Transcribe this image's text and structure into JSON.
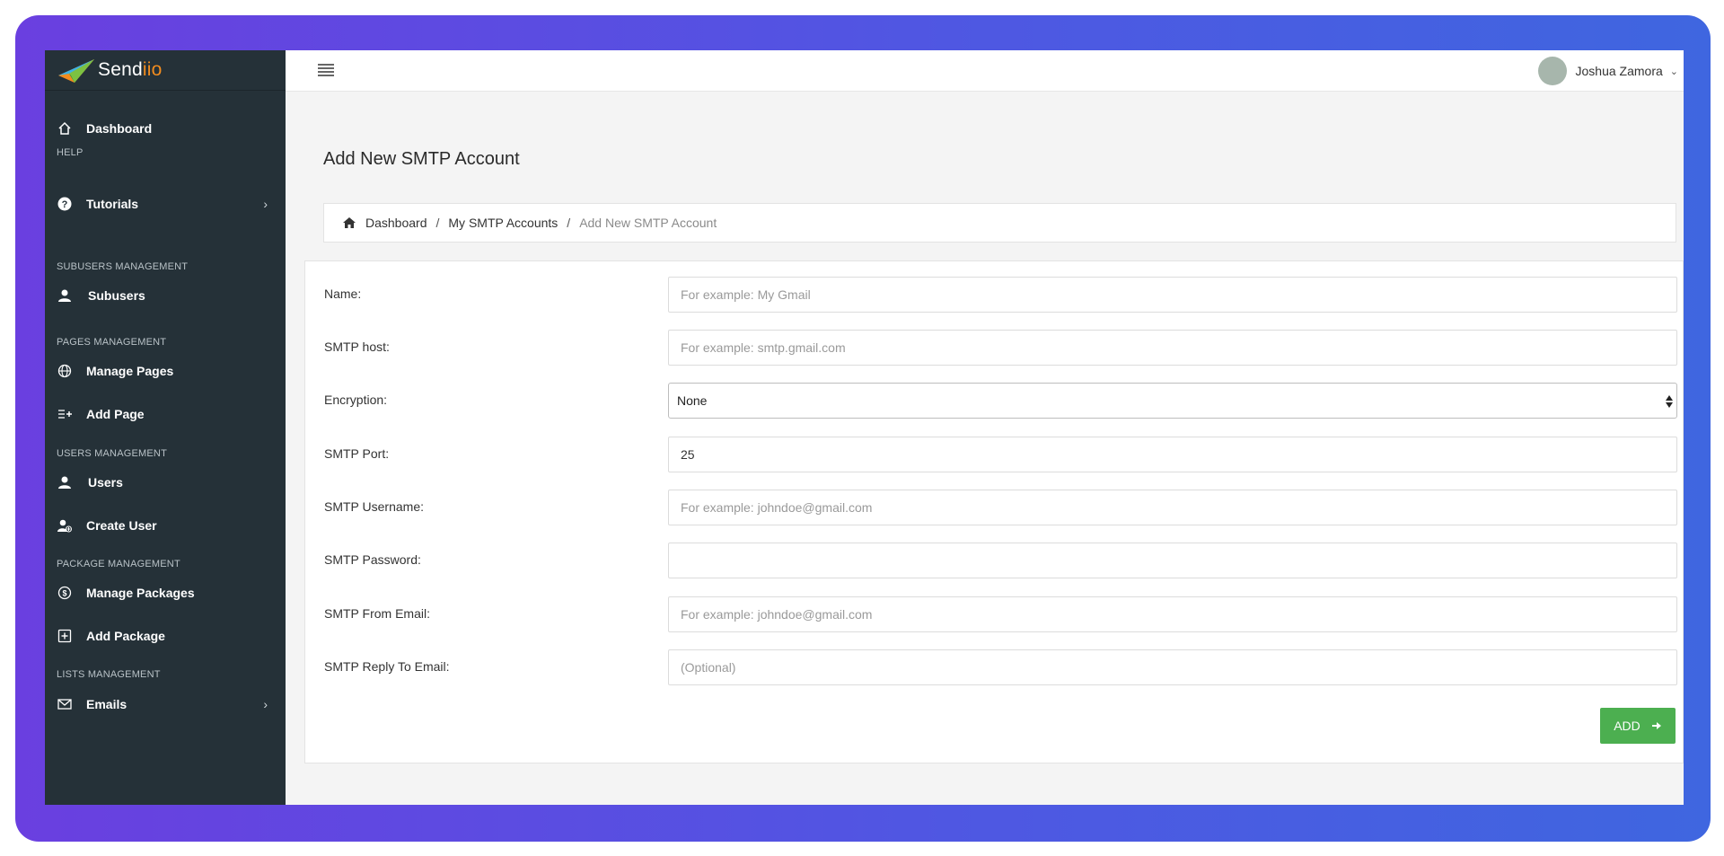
{
  "brand": {
    "logo_text_main": "Send",
    "logo_text_accent": "iio"
  },
  "sidebar": {
    "items": [
      {
        "label": "Dashboard",
        "icon": "home-icon"
      },
      {
        "label": "Tutorials",
        "icon": "help-circle-icon",
        "chevron": "›"
      },
      {
        "label": "Subusers",
        "icon": "user-icon"
      },
      {
        "label": "Manage Pages",
        "icon": "globe-icon"
      },
      {
        "label": "Add Page",
        "icon": "list-add-icon"
      },
      {
        "label": "Users",
        "icon": "user-icon"
      },
      {
        "label": "Create User",
        "icon": "user-add-icon"
      },
      {
        "label": "Manage Packages",
        "icon": "dollar-circle-icon"
      },
      {
        "label": "Add Package",
        "icon": "square-plus-icon"
      },
      {
        "label": "Emails",
        "icon": "envelope-icon",
        "chevron": "›"
      }
    ],
    "headers": {
      "help": "HELP",
      "subusers": "SUBUSERS MANAGEMENT",
      "pages": "PAGES MANAGEMENT",
      "users": "USERS MANAGEMENT",
      "packages": "PACKAGE MANAGEMENT",
      "lists": "LISTS MANAGEMENT"
    }
  },
  "topbar": {
    "user_name": "Joshua Zamora"
  },
  "page": {
    "title": "Add New SMTP Account"
  },
  "breadcrumb": {
    "items": [
      "Dashboard",
      "My SMTP Accounts"
    ],
    "current": "Add New SMTP Account",
    "separator": "/"
  },
  "form": {
    "name": {
      "label": "Name:",
      "placeholder": "For example: My Gmail",
      "value": ""
    },
    "host": {
      "label": "SMTP host:",
      "placeholder": "For example: smtp.gmail.com",
      "value": ""
    },
    "encryption": {
      "label": "Encryption:",
      "selected": "None"
    },
    "port": {
      "label": "SMTP Port:",
      "value": "25"
    },
    "username": {
      "label": "SMTP Username:",
      "placeholder": "For example: johndoe@gmail.com",
      "value": ""
    },
    "password": {
      "label": "SMTP Password:",
      "value": ""
    },
    "from_email": {
      "label": "SMTP From Email:",
      "placeholder": "For example: johndoe@gmail.com",
      "value": ""
    },
    "reply_to": {
      "label": "SMTP Reply To Email:",
      "placeholder": "(Optional)",
      "value": ""
    },
    "submit_label": "ADD"
  },
  "colors": {
    "sidebar_bg": "#253138",
    "accent_orange": "#f28c1e",
    "button_green": "#4caf50",
    "frame_gradient_start": "#6a3fe0",
    "frame_gradient_end": "#3f66e0"
  }
}
